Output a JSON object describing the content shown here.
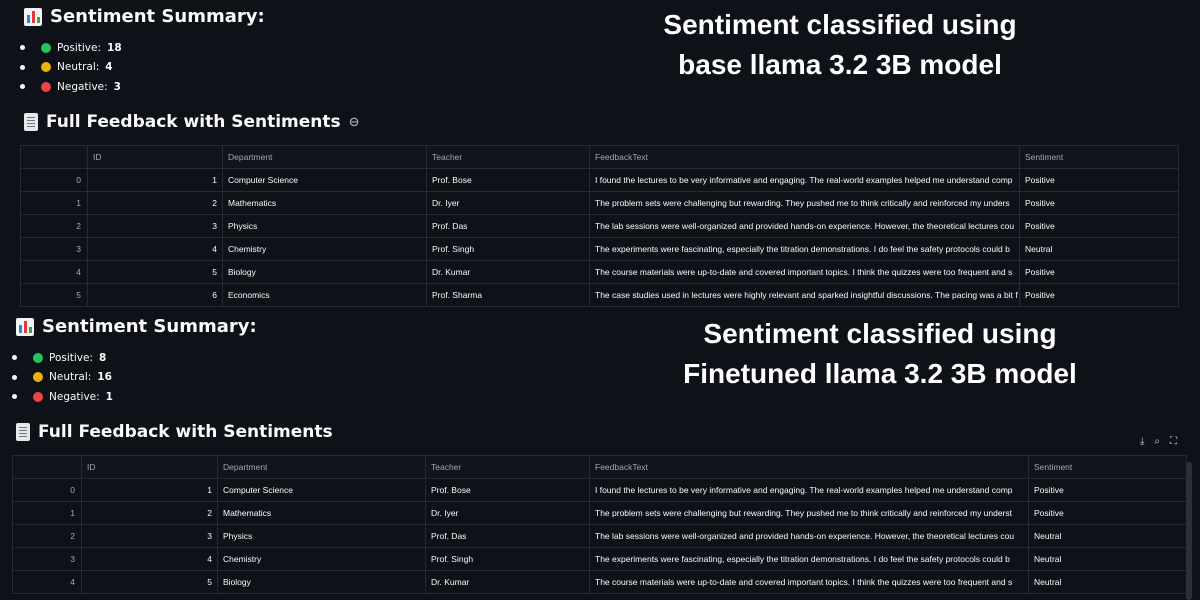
{
  "top": {
    "summary_title": "Sentiment Summary:",
    "summary": [
      {
        "label": "Positive:",
        "value": "18",
        "color": "#22c55e"
      },
      {
        "label": "Neutral:",
        "value": "4",
        "color": "#eab308"
      },
      {
        "label": "Negative:",
        "value": "3",
        "color": "#ef4444"
      }
    ],
    "caption": [
      "Sentiment classified using",
      "base llama 3.2 3B model"
    ],
    "feedback_title": "Full Feedback with Sentiments",
    "columns": [
      "",
      "ID",
      "Department",
      "Teacher",
      "FeedbackText",
      "Sentiment"
    ],
    "rows": [
      [
        "0",
        "1",
        "Computer Science",
        "Prof. Bose",
        "I found the lectures to be very informative and engaging. The real-world examples helped me understand comp",
        "Positive"
      ],
      [
        "1",
        "2",
        "Mathematics",
        "Dr. Iyer",
        "The problem sets were challenging but rewarding. They pushed me to think critically and reinforced my unders",
        "Positive"
      ],
      [
        "2",
        "3",
        "Physics",
        "Prof. Das",
        "The lab sessions were well-organized and provided hands-on experience. However, the theoretical lectures cou",
        "Positive"
      ],
      [
        "3",
        "4",
        "Chemistry",
        "Prof. Singh",
        "The experiments were fascinating, especially the titration demonstrations. I do feel the safety protocols could b",
        "Neutral"
      ],
      [
        "4",
        "5",
        "Biology",
        "Dr. Kumar",
        "The course materials were up-to-date and covered important topics. I think the quizzes were too frequent and s",
        "Positive"
      ],
      [
        "5",
        "6",
        "Economics",
        "Prof. Sharma",
        "The case studies used in lectures were highly relevant and sparked insightful discussions. The pacing was a bit f",
        "Positive"
      ]
    ]
  },
  "bottom": {
    "summary_title": "Sentiment Summary:",
    "summary": [
      {
        "label": "Positive:",
        "value": "8",
        "color": "#22c55e"
      },
      {
        "label": "Neutral:",
        "value": "16",
        "color": "#eab308"
      },
      {
        "label": "Negative:",
        "value": "1",
        "color": "#ef4444"
      }
    ],
    "caption": [
      "Sentiment classified using",
      "Finetuned llama 3.2 3B model"
    ],
    "feedback_title": "Full Feedback with Sentiments",
    "columns": [
      "",
      "ID",
      "Department",
      "Teacher",
      "FeedbackText",
      "Sentiment"
    ],
    "rows": [
      [
        "0",
        "1",
        "Computer Science",
        "Prof. Bose",
        "I found the lectures to be very informative and engaging. The real-world examples helped me understand comp",
        "Positive"
      ],
      [
        "1",
        "2",
        "Mathematics",
        "Dr. Iyer",
        "The problem sets were challenging but rewarding. They pushed me to think critically and reinforced my underst",
        "Positive"
      ],
      [
        "2",
        "3",
        "Physics",
        "Prof. Das",
        "The lab sessions were well-organized and provided hands-on experience. However, the theoretical lectures cou",
        "Neutral"
      ],
      [
        "3",
        "4",
        "Chemistry",
        "Prof. Singh",
        "The experiments were fascinating, especially the titration demonstrations. I do feel the safety protocols could b",
        "Neutral"
      ],
      [
        "4",
        "5",
        "Biology",
        "Dr. Kumar",
        "The course materials were up-to-date and covered important topics. I think the quizzes were too frequent and s",
        "Neutral"
      ]
    ],
    "toolbar": {
      "download_icon": "download-icon",
      "search_icon": "search-icon",
      "fullscreen_icon": "fullscreen-icon"
    }
  }
}
